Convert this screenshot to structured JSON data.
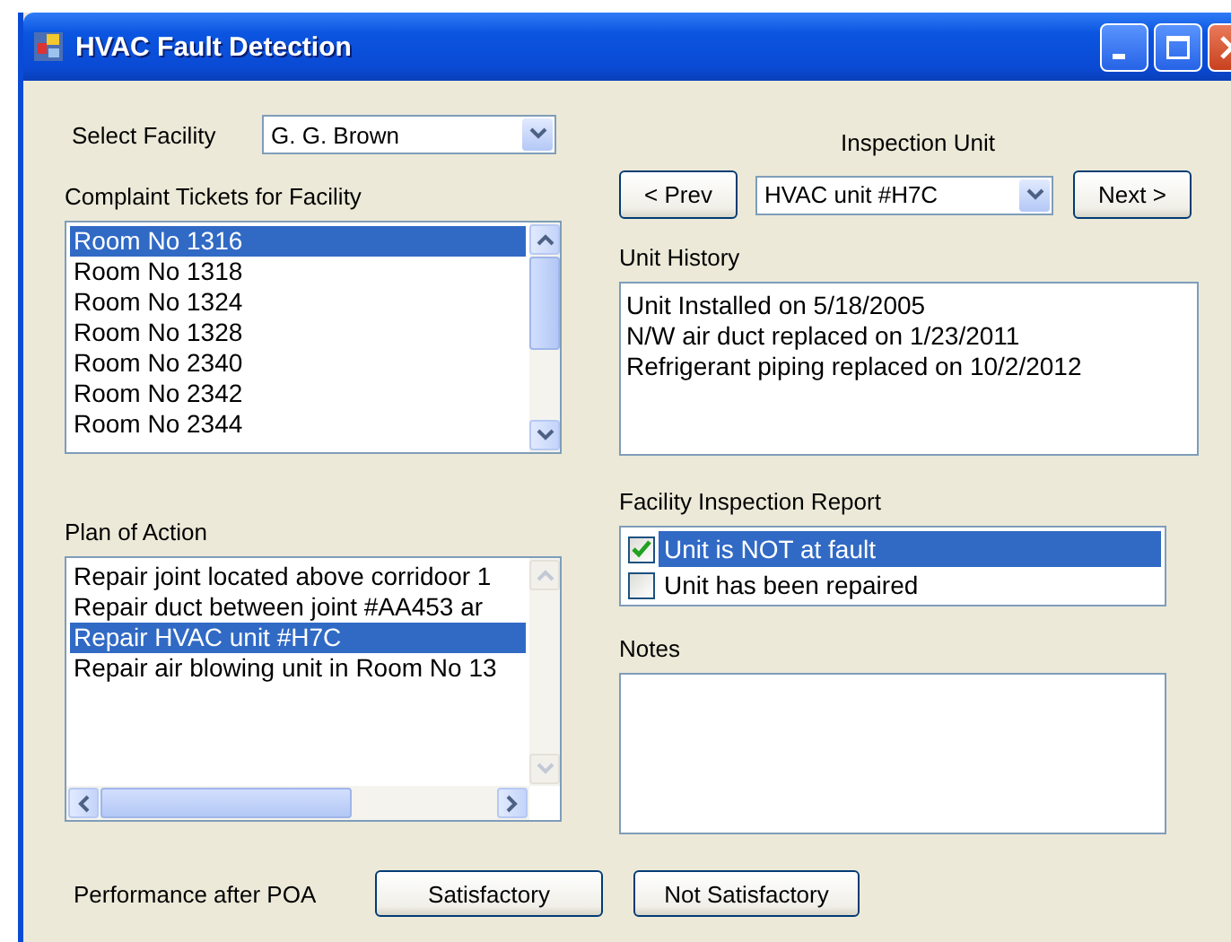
{
  "window": {
    "title": "HVAC Fault Detection"
  },
  "facility": {
    "label": "Select Facility",
    "value": "G. G. Brown"
  },
  "complaint_tickets": {
    "label": "Complaint Tickets for Facility",
    "items": [
      {
        "text": "Room No 1316",
        "selected": true
      },
      {
        "text": "Room No 1318",
        "selected": false
      },
      {
        "text": "Room No 1324",
        "selected": false
      },
      {
        "text": "Room No 1328",
        "selected": false
      },
      {
        "text": "Room No 2340",
        "selected": false
      },
      {
        "text": "Room No 2342",
        "selected": false
      },
      {
        "text": "Room No 2344",
        "selected": false
      }
    ]
  },
  "plan_of_action": {
    "label": "Plan of Action",
    "items": [
      {
        "text": "Repair joint located above corridoor 1",
        "selected": false
      },
      {
        "text": "Repair duct between joint #AA453 ar",
        "selected": false
      },
      {
        "text": "Repair HVAC unit #H7C",
        "selected": true
      },
      {
        "text": "Repair air blowing unit in Room No 13",
        "selected": false
      }
    ]
  },
  "inspection_unit": {
    "label": "Inspection Unit",
    "prev": "< Prev",
    "value": "HVAC unit #H7C",
    "next": "Next >"
  },
  "unit_history": {
    "label": "Unit History",
    "lines": [
      "Unit Installed on 5/18/2005",
      "N/W air duct replaced on 1/23/2011",
      "Refrigerant piping replaced on 10/2/2012"
    ]
  },
  "inspection_report": {
    "label": "Facility Inspection Report",
    "items": [
      {
        "text": "Unit is NOT at fault",
        "checked": true,
        "selected": true
      },
      {
        "text": "Unit has been repaired",
        "checked": false,
        "selected": false
      }
    ]
  },
  "notes": {
    "label": "Notes"
  },
  "performance": {
    "label": "Performance after POA",
    "buttons": [
      "Satisfactory",
      "Not Satisfactory"
    ]
  }
}
